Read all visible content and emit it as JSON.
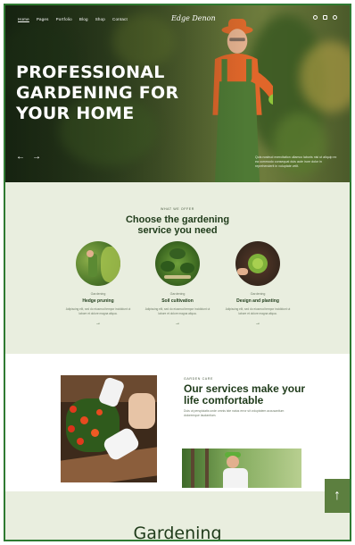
{
  "nav": {
    "links": [
      "Home",
      "Pages",
      "Portfolio",
      "Blog",
      "Shop",
      "Contact"
    ],
    "logo": "Edge Denon"
  },
  "hero": {
    "title": "PROFESSIONAL GARDENING FOR YOUR HOME",
    "prev_arrow": "←",
    "next_arrow": "→",
    "caption": "Quis nostrud exercitation ullamco laboris nisi ut aliquip ex ea commodo consequat duis aute irure dolor in reprehenderit in voluptate velit."
  },
  "services": {
    "eyebrow": "WHAT WE OFFER",
    "title_line1": "Choose the gardening",
    "title_line2": "service you need",
    "cards": [
      {
        "tag": "Gardening",
        "name": "Hedge pruning",
        "desc": "Adipiscing elit, sed do eiusmod tempor incididunt ut labore et dolore magna aliqua.",
        "arrow": "→"
      },
      {
        "tag": "Gardening",
        "name": "Soil cultivation",
        "desc": "Adipiscing elit, sed do eiusmod tempor incididunt ut labore et dolore magna aliqua.",
        "arrow": "→"
      },
      {
        "tag": "Gardening",
        "name": "Design and planting",
        "desc": "Adipiscing elit, sed do eiusmod tempor incididunt ut labore et dolore magna aliqua.",
        "arrow": "→"
      }
    ]
  },
  "comfort": {
    "eyebrow": "GARDEN CARE",
    "title": "Our services make your life comfortable",
    "desc": "Duis ut perspiciatis unde omnis iste natus error sit voluptatem accusantium doloremque laudantium."
  },
  "bottom": {
    "title": "Gardening"
  },
  "scroll_top": {
    "icon": "↑"
  },
  "colors": {
    "accent": "#5c7f3f",
    "dark_green": "#1f3b1a",
    "light_bg": "#e9eedf"
  }
}
